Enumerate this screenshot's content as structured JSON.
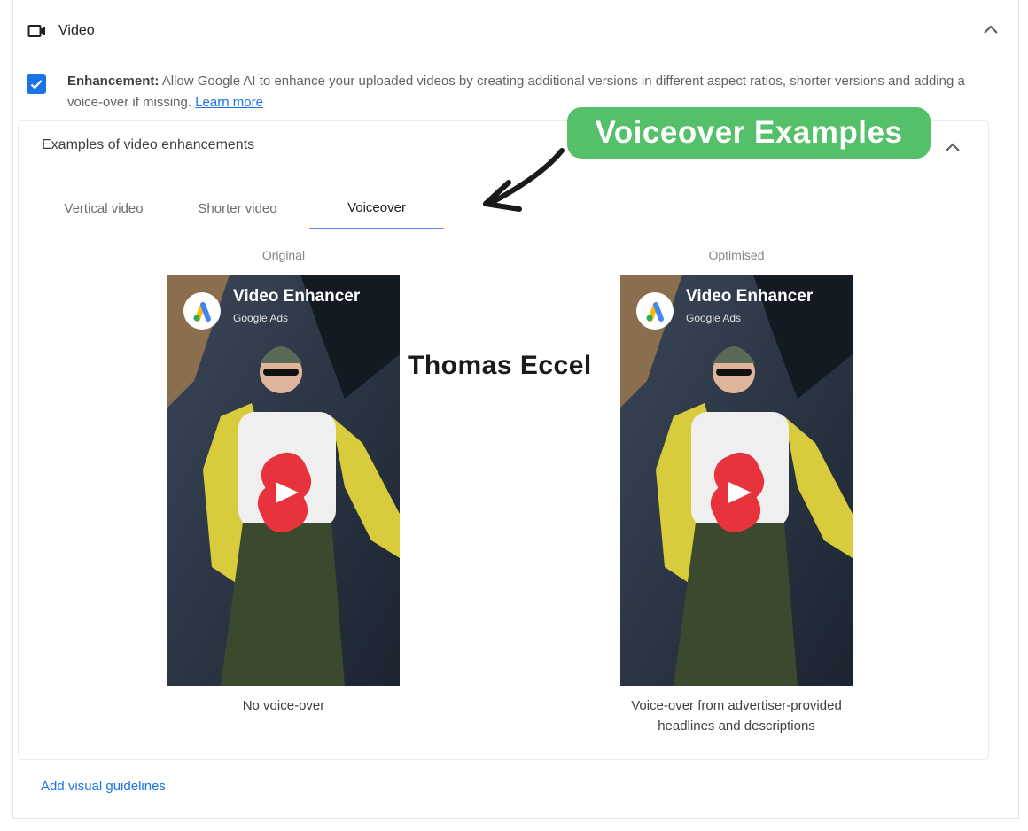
{
  "video_section": {
    "title": "Video",
    "enhancement_label": "Enhancement:",
    "enhancement_text": "Allow Google AI to enhance your uploaded videos by creating additional versions in different aspect ratios, shorter versions and adding a voice-over if missing.",
    "learn_more": "Learn more",
    "checked": true
  },
  "examples": {
    "title": "Examples of video enhancements",
    "tabs": [
      {
        "label": "Vertical video",
        "active": false
      },
      {
        "label": "Shorter video",
        "active": false
      },
      {
        "label": "Voiceover",
        "active": true
      }
    ],
    "original": {
      "label": "Original",
      "thumb_title": "Video Enhancer",
      "thumb_subtitle": "Google Ads",
      "caption_line1": "No voice-over",
      "caption_line2": ""
    },
    "optimised": {
      "label": "Optimised",
      "thumb_title": "Video Enhancer",
      "thumb_subtitle": "Google Ads",
      "caption_line1": "Voice-over from advertiser-provided",
      "caption_line2": "headlines and descriptions"
    }
  },
  "overlay": {
    "callout": "Voiceover Examples",
    "watermark": "Thomas Eccel"
  },
  "footer": {
    "add_guidelines": "Add visual guidelines"
  },
  "colors": {
    "accent": "#1a73e8",
    "callout_bg": "#54c06a",
    "shorts_red": "#e8323c",
    "jacket_yellow": "#d9cc3c"
  }
}
